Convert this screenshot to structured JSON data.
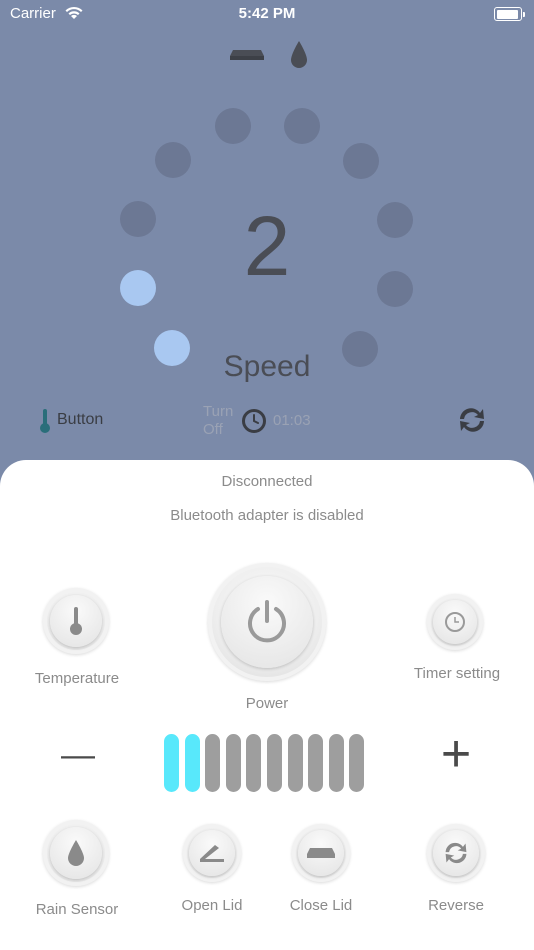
{
  "status_bar": {
    "carrier": "Carrier",
    "time": "5:42 PM"
  },
  "dial": {
    "speed_value": "2",
    "speed_label": "Speed",
    "active_level": 2,
    "total_levels": 10
  },
  "info_row": {
    "button_label": "Button",
    "turn_off_label": "Turn\nOff",
    "timer_value": "01:03"
  },
  "connection": {
    "status": "Disconnected",
    "message": "Bluetooth adapter is disabled"
  },
  "controls": {
    "temperature_label": "Temperature",
    "power_label": "Power",
    "timer_label": "Timer setting",
    "minus_label": "—",
    "plus_label": "+",
    "rain_sensor_label": "Rain Sensor",
    "open_lid_label": "Open Lid",
    "close_lid_label": "Close Lid",
    "reverse_label": "Reverse"
  },
  "level_bar": {
    "active": 2,
    "total": 10
  },
  "colors": {
    "background": "#7b8aa9",
    "dot_active": "#a9c8f1",
    "bar_active": "#58e8fb",
    "bar_inactive": "#9e9e9e"
  }
}
